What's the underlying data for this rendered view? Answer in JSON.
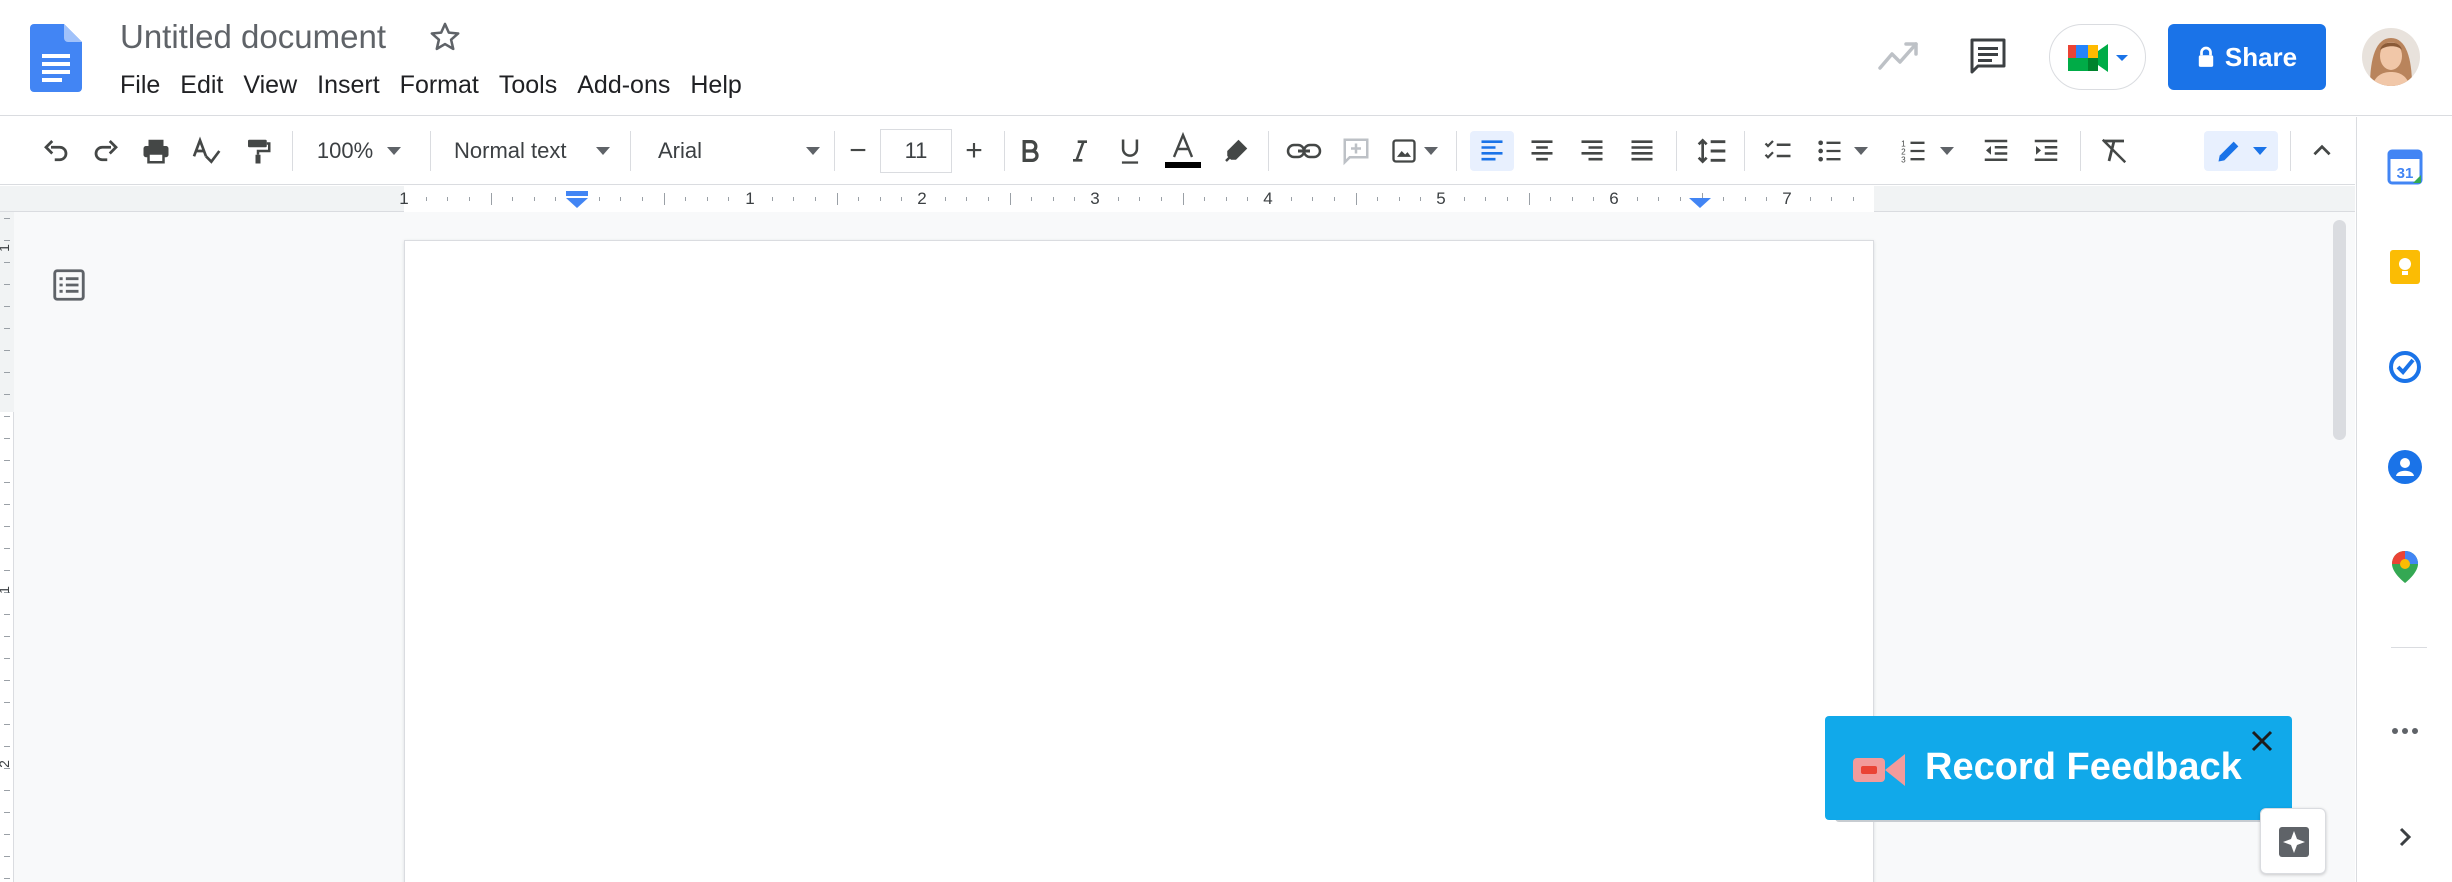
{
  "header": {
    "title": "Untitled document",
    "menu": [
      "File",
      "Edit",
      "View",
      "Insert",
      "Format",
      "Tools",
      "Add-ons",
      "Help"
    ],
    "share_label": "Share"
  },
  "toolbar": {
    "zoom": "100%",
    "style": "Normal text",
    "font": "Arial",
    "font_size": "11",
    "decrease_symbol": "−",
    "increase_symbol": "+"
  },
  "ruler": {
    "numbers": [
      "1",
      "1",
      "2",
      "3",
      "4",
      "5",
      "6",
      "7"
    ]
  },
  "vertical_ruler": {
    "numbers": [
      "1",
      "1",
      "2"
    ]
  },
  "record_feedback": {
    "label": "Record Feedback"
  },
  "colors": {
    "accent": "#1a73e8",
    "feedback": "#11a9ea",
    "text_color_swatch": "#000000"
  },
  "icons": [
    "docs-logo",
    "star-icon",
    "activity-icon",
    "comments-icon",
    "meet-icon",
    "lock-icon",
    "undo-icon",
    "redo-icon",
    "print-icon",
    "spellcheck-icon",
    "paint-format-icon",
    "bold-icon",
    "italic-icon",
    "underline-icon",
    "text-color-icon",
    "highlight-icon",
    "link-icon",
    "add-comment-icon",
    "image-icon",
    "align-left-icon",
    "align-center-icon",
    "align-right-icon",
    "justify-icon",
    "line-spacing-icon",
    "checklist-icon",
    "bulleted-list-icon",
    "numbered-list-icon",
    "decrease-indent-icon",
    "increase-indent-icon",
    "clear-formatting-icon",
    "pencil-icon",
    "collapse-icon",
    "outline-icon",
    "calendar-icon",
    "keep-icon",
    "tasks-icon",
    "contacts-icon",
    "maps-icon",
    "more-icon",
    "expand-panel-icon",
    "camera-icon",
    "close-icon",
    "explore-icon"
  ]
}
